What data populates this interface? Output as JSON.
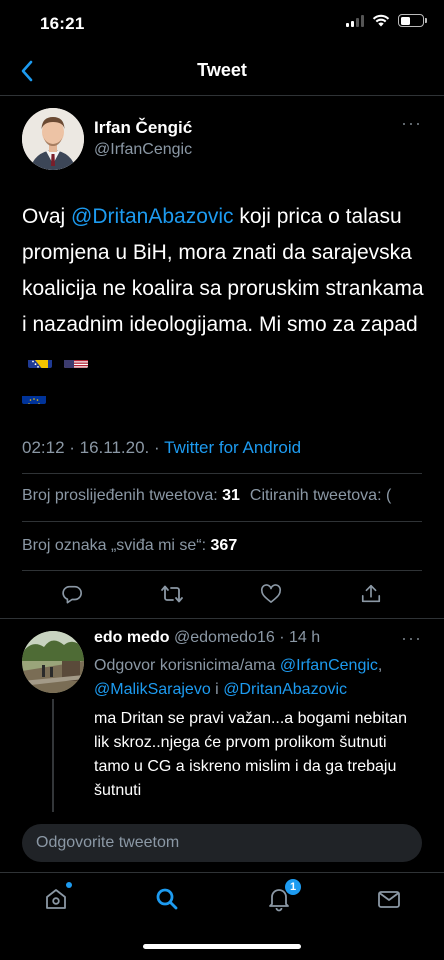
{
  "status_bar": {
    "time": "16:21"
  },
  "header": {
    "title": "Tweet",
    "back_icon": "chevron-left-icon"
  },
  "tweet": {
    "author_name": "Irfan Čengić",
    "author_handle": "@IrfanCengic",
    "text_before": "Ovaj ",
    "mention": "@DritanAbazovic",
    "text_after": " koji prica o talasu promjena u BiH, mora znati da sarajevska koalicija ne koalira sa proruskim strankama i nazadnim ideologijama. Mi smo za zapad",
    "flags": [
      "bosnia-flag",
      "usa-flag",
      "eu-flag"
    ],
    "time": "02:12 · 16.11.20. · ",
    "source": "Twitter for Android",
    "retweets_label": "Broj proslijeđenih tweetova: ",
    "retweets_count": "31",
    "quotes_label": "Citiranih tweetova: (",
    "likes_label": "Broj oznaka „sviđa mi se“: ",
    "likes_count": "367",
    "actions": [
      "reply-icon",
      "retweet-icon",
      "like-icon",
      "share-icon"
    ]
  },
  "reply": {
    "name": "edo medo",
    "handle": "@edomedo16",
    "time": " · 14 h",
    "reply_prefix": "Odgovor korisnicima/ama ",
    "mention1": "@IrfanCengic",
    "separator": ",",
    "mention2": "@MalikSarajevo",
    "conjunction": " i ",
    "mention3": "@DritanAbazovic",
    "text": "ma Dritan se pravi važan...a bogami nebitan lik skroz..njega će prvom prolikom šutnuti tamo u CG a iskreno mislim i da ga trebaju šutnuti"
  },
  "compose": {
    "placeholder": "Odgovorite tweetom"
  },
  "bottom_nav": {
    "tabs": [
      "home-icon",
      "search-icon",
      "notifications-icon",
      "messages-icon"
    ],
    "notification_badge": "1"
  },
  "colors": {
    "accent": "#1d9bf0",
    "background": "#000000",
    "muted": "#8b98a5",
    "border": "#2f3336"
  }
}
